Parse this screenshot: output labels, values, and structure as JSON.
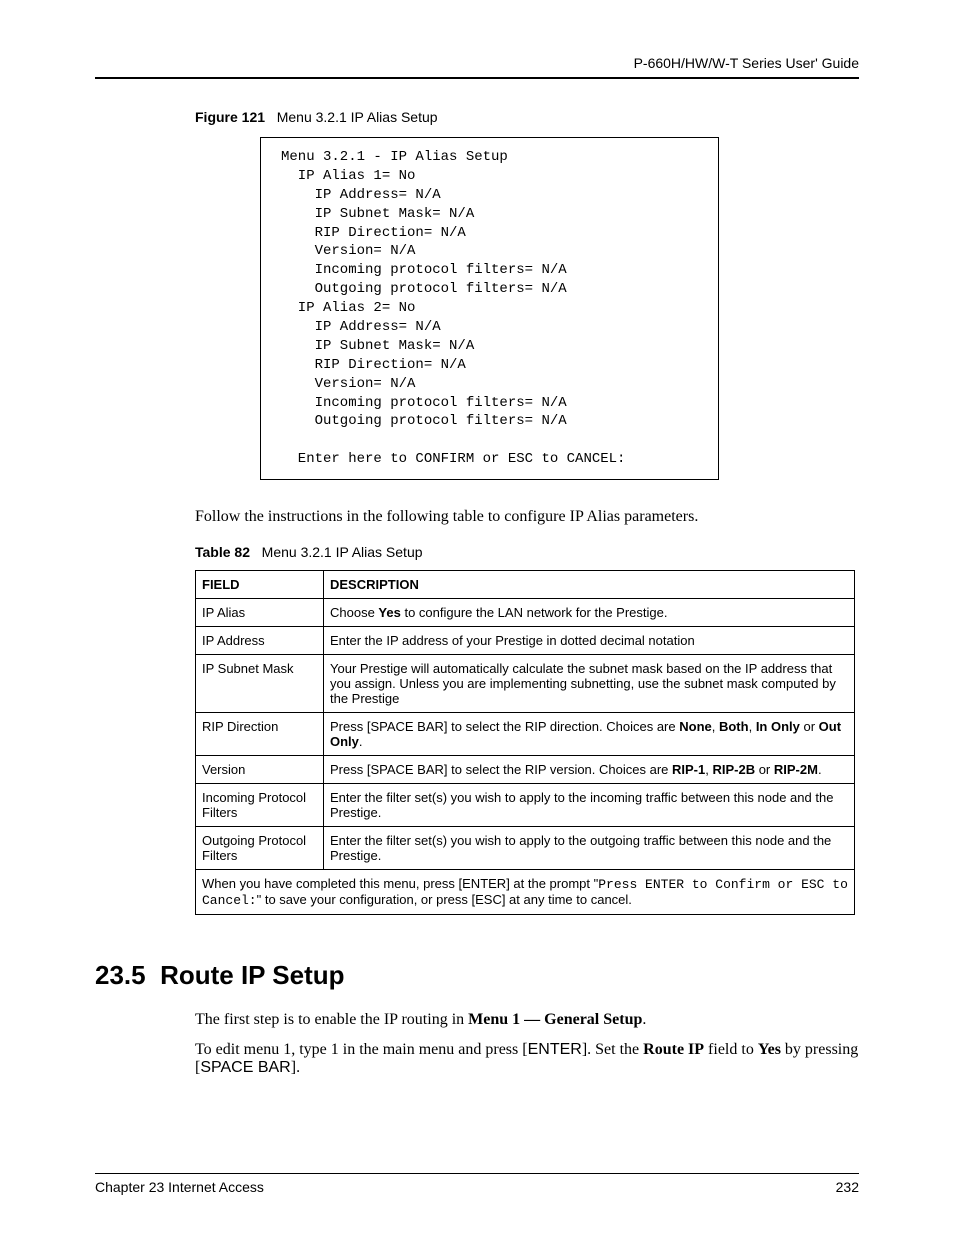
{
  "header": {
    "title": "P-660H/HW/W-T Series User' Guide"
  },
  "figure": {
    "label": "Figure 121",
    "title": "Menu 3.2.1 IP Alias Setup",
    "terminal": "Menu 3.2.1 - IP Alias Setup\n  IP Alias 1= No\n    IP Address= N/A\n    IP Subnet Mask= N/A\n    RIP Direction= N/A\n    Version= N/A\n    Incoming protocol filters= N/A\n    Outgoing protocol filters= N/A\n  IP Alias 2= No\n    IP Address= N/A\n    IP Subnet Mask= N/A\n    RIP Direction= N/A\n    Version= N/A\n    Incoming protocol filters= N/A\n    Outgoing protocol filters= N/A\n\n  Enter here to CONFIRM or ESC to CANCEL:"
  },
  "para1": "Follow the instructions in the following table to configure IP Alias parameters.",
  "table": {
    "label": "Table 82",
    "title": "Menu 3.2.1 IP Alias Setup",
    "headers": {
      "field": "FIELD",
      "desc": "DESCRIPTION"
    },
    "rows": [
      {
        "field": "IP Alias",
        "desc_pre": "Choose ",
        "desc_b1": "Yes",
        "desc_post": " to configure the LAN network for the Prestige."
      },
      {
        "field": "IP Address",
        "desc": "Enter the IP address of your Prestige in dotted decimal notation"
      },
      {
        "field": "IP Subnet Mask",
        "desc": "Your Prestige will automatically calculate the subnet mask based on the IP address that you assign. Unless you are implementing subnetting, use the subnet mask computed by the Prestige"
      },
      {
        "field": "RIP Direction",
        "desc_pre": "Press [SPACE BAR] to select the RIP direction.  Choices are ",
        "desc_b1": "None",
        "desc_m1": ", ",
        "desc_b2": "Both",
        "desc_m2": ", ",
        "desc_b3": "In Only",
        "desc_m3": " or ",
        "desc_b4": "Out Only",
        "desc_post": "."
      },
      {
        "field": "Version",
        "desc_pre": "Press [SPACE BAR] to select the RIP version. Choices are ",
        "desc_b1": "RIP-1",
        "desc_m1": ", ",
        "desc_b2": "RIP-2B",
        "desc_m2": " or ",
        "desc_b3": "RIP-2M",
        "desc_post": "."
      },
      {
        "field": "Incoming Protocol Filters",
        "desc": "Enter the filter set(s) you wish to apply to the incoming traffic between this node and the Prestige."
      },
      {
        "field": "Outgoing Protocol Filters",
        "desc": "Enter the filter set(s) you wish to apply to the outgoing traffic between this node and the Prestige."
      }
    ],
    "footer_pre": "When you have completed this menu, press [ENTER] at the prompt \"",
    "footer_mono": "Press ENTER to Confirm or ESC to Cancel:",
    "footer_post": "\" to save your configuration, or press [ESC] at any time to cancel."
  },
  "section": {
    "num": "23.5",
    "title": "Route IP Setup",
    "p1_pre": "The first step is to enable the IP routing in ",
    "p1_b": "Menu 1 — General Setup",
    "p1_post": ".",
    "p2_a": "To edit menu 1, type 1 in the main menu and press [",
    "p2_enter": "ENTER",
    "p2_b": "].  Set the ",
    "p2_bold": "Route IP",
    "p2_c": " field to ",
    "p2_yes": "Yes",
    "p2_d": " by pressing [",
    "p2_space": "SPACE BAR",
    "p2_e": "]."
  },
  "footer": {
    "chapter": "Chapter 23 Internet Access",
    "page": "232"
  }
}
